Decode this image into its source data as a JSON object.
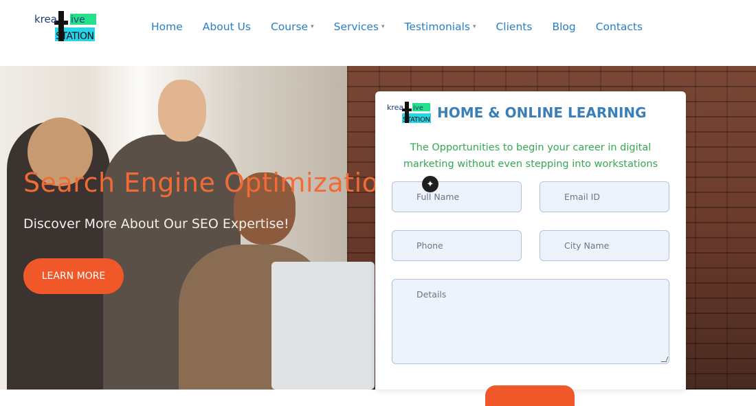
{
  "header": {
    "logo_text_top": "krea",
    "logo_text_ive": "ive",
    "logo_text_bottom": "STATION",
    "nav": [
      {
        "label": "Home",
        "dropdown": false
      },
      {
        "label": "About Us",
        "dropdown": false
      },
      {
        "label": "Course",
        "dropdown": true
      },
      {
        "label": "Services",
        "dropdown": true
      },
      {
        "label": "Testimonials",
        "dropdown": true
      },
      {
        "label": "Clients",
        "dropdown": false
      },
      {
        "label": "Blog",
        "dropdown": false
      },
      {
        "label": "Contacts",
        "dropdown": false
      }
    ]
  },
  "hero": {
    "title": "Search Engine Optimizatio",
    "subtitle": "Discover More About Our SEO Expertise!",
    "button": "LEARN MORE"
  },
  "panel": {
    "title": "HOME & ONLINE LEARNING",
    "text": "The Opportunities to begin your career in digital marketing without even stepping into workstations",
    "fields": {
      "full_name": "Full Name",
      "email": "Email ID",
      "phone": "Phone",
      "city": "City Name",
      "details": "Details"
    }
  },
  "colors": {
    "accent": "#f0582a",
    "link": "#2a7fc4",
    "green": "#34a853"
  },
  "icons": {
    "chat": "chat-sparkle-icon"
  }
}
